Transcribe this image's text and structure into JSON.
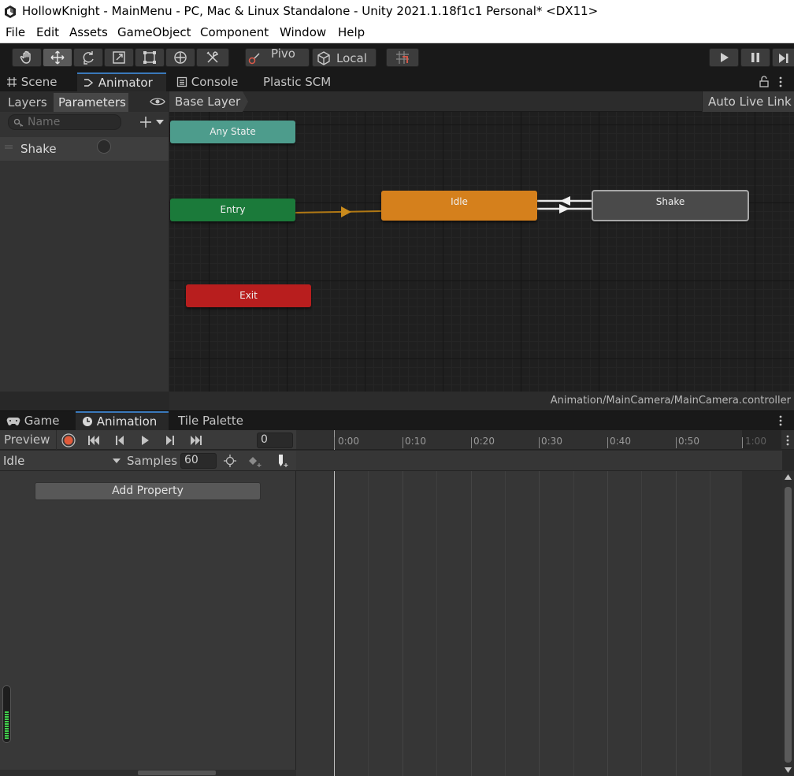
{
  "window": {
    "title": "HollowKnight - MainMenu - PC, Mac & Linux Standalone - Unity 2021.1.18f1c1 Personal* <DX11>"
  },
  "menu": [
    "File",
    "Edit",
    "Assets",
    "GameObject",
    "Component",
    "Window",
    "Help"
  ],
  "toolbar": {
    "tools": [
      "hand-tool",
      "move-tool",
      "rotate-tool",
      "scale-tool",
      "rect-tool",
      "transform-tool",
      "custom-tool"
    ],
    "selected_tool": "move-tool",
    "pivot_label": "Pivo",
    "local_label": "Local"
  },
  "upper_tabs": [
    {
      "label": "Scene",
      "icon": "grid-icon"
    },
    {
      "label": "Animator",
      "icon": "animator-icon",
      "active": true
    },
    {
      "label": "Console",
      "icon": "console-icon"
    },
    {
      "label": "Plastic SCM"
    }
  ],
  "animator": {
    "left_tabs": [
      "Layers",
      "Parameters"
    ],
    "active_left_tab": "Parameters",
    "search_placeholder": "Name",
    "parameters": [
      {
        "name": "Shake",
        "type": "trigger"
      }
    ],
    "breadcrumb": "Base Layer",
    "auto_live_link": "Auto Live Link",
    "states": [
      {
        "name": "Any State",
        "color": "#4d9c8c"
      },
      {
        "name": "Entry",
        "color": "#1b7a3a"
      },
      {
        "name": "Idle",
        "color": "#d5801c",
        "default": true
      },
      {
        "name": "Shake",
        "color": "#4a4a4a"
      },
      {
        "name": "Exit",
        "color": "#b81e1e"
      }
    ],
    "controller_path": "Animation/MainCamera/MainCamera.controller"
  },
  "lower_tabs": [
    {
      "label": "Game",
      "icon": "gamepad-icon"
    },
    {
      "label": "Animation",
      "icon": "clock-icon",
      "active": true
    },
    {
      "label": "Tile Palette"
    }
  ],
  "animation": {
    "preview_label": "Preview",
    "frame": "0",
    "clip": "Idle",
    "samples_label": "Samples",
    "samples": "60",
    "add_property": "Add Property",
    "ruler": [
      "0:00",
      "0:10",
      "0:20",
      "0:30",
      "0:40",
      "0:50",
      "1:00"
    ]
  }
}
